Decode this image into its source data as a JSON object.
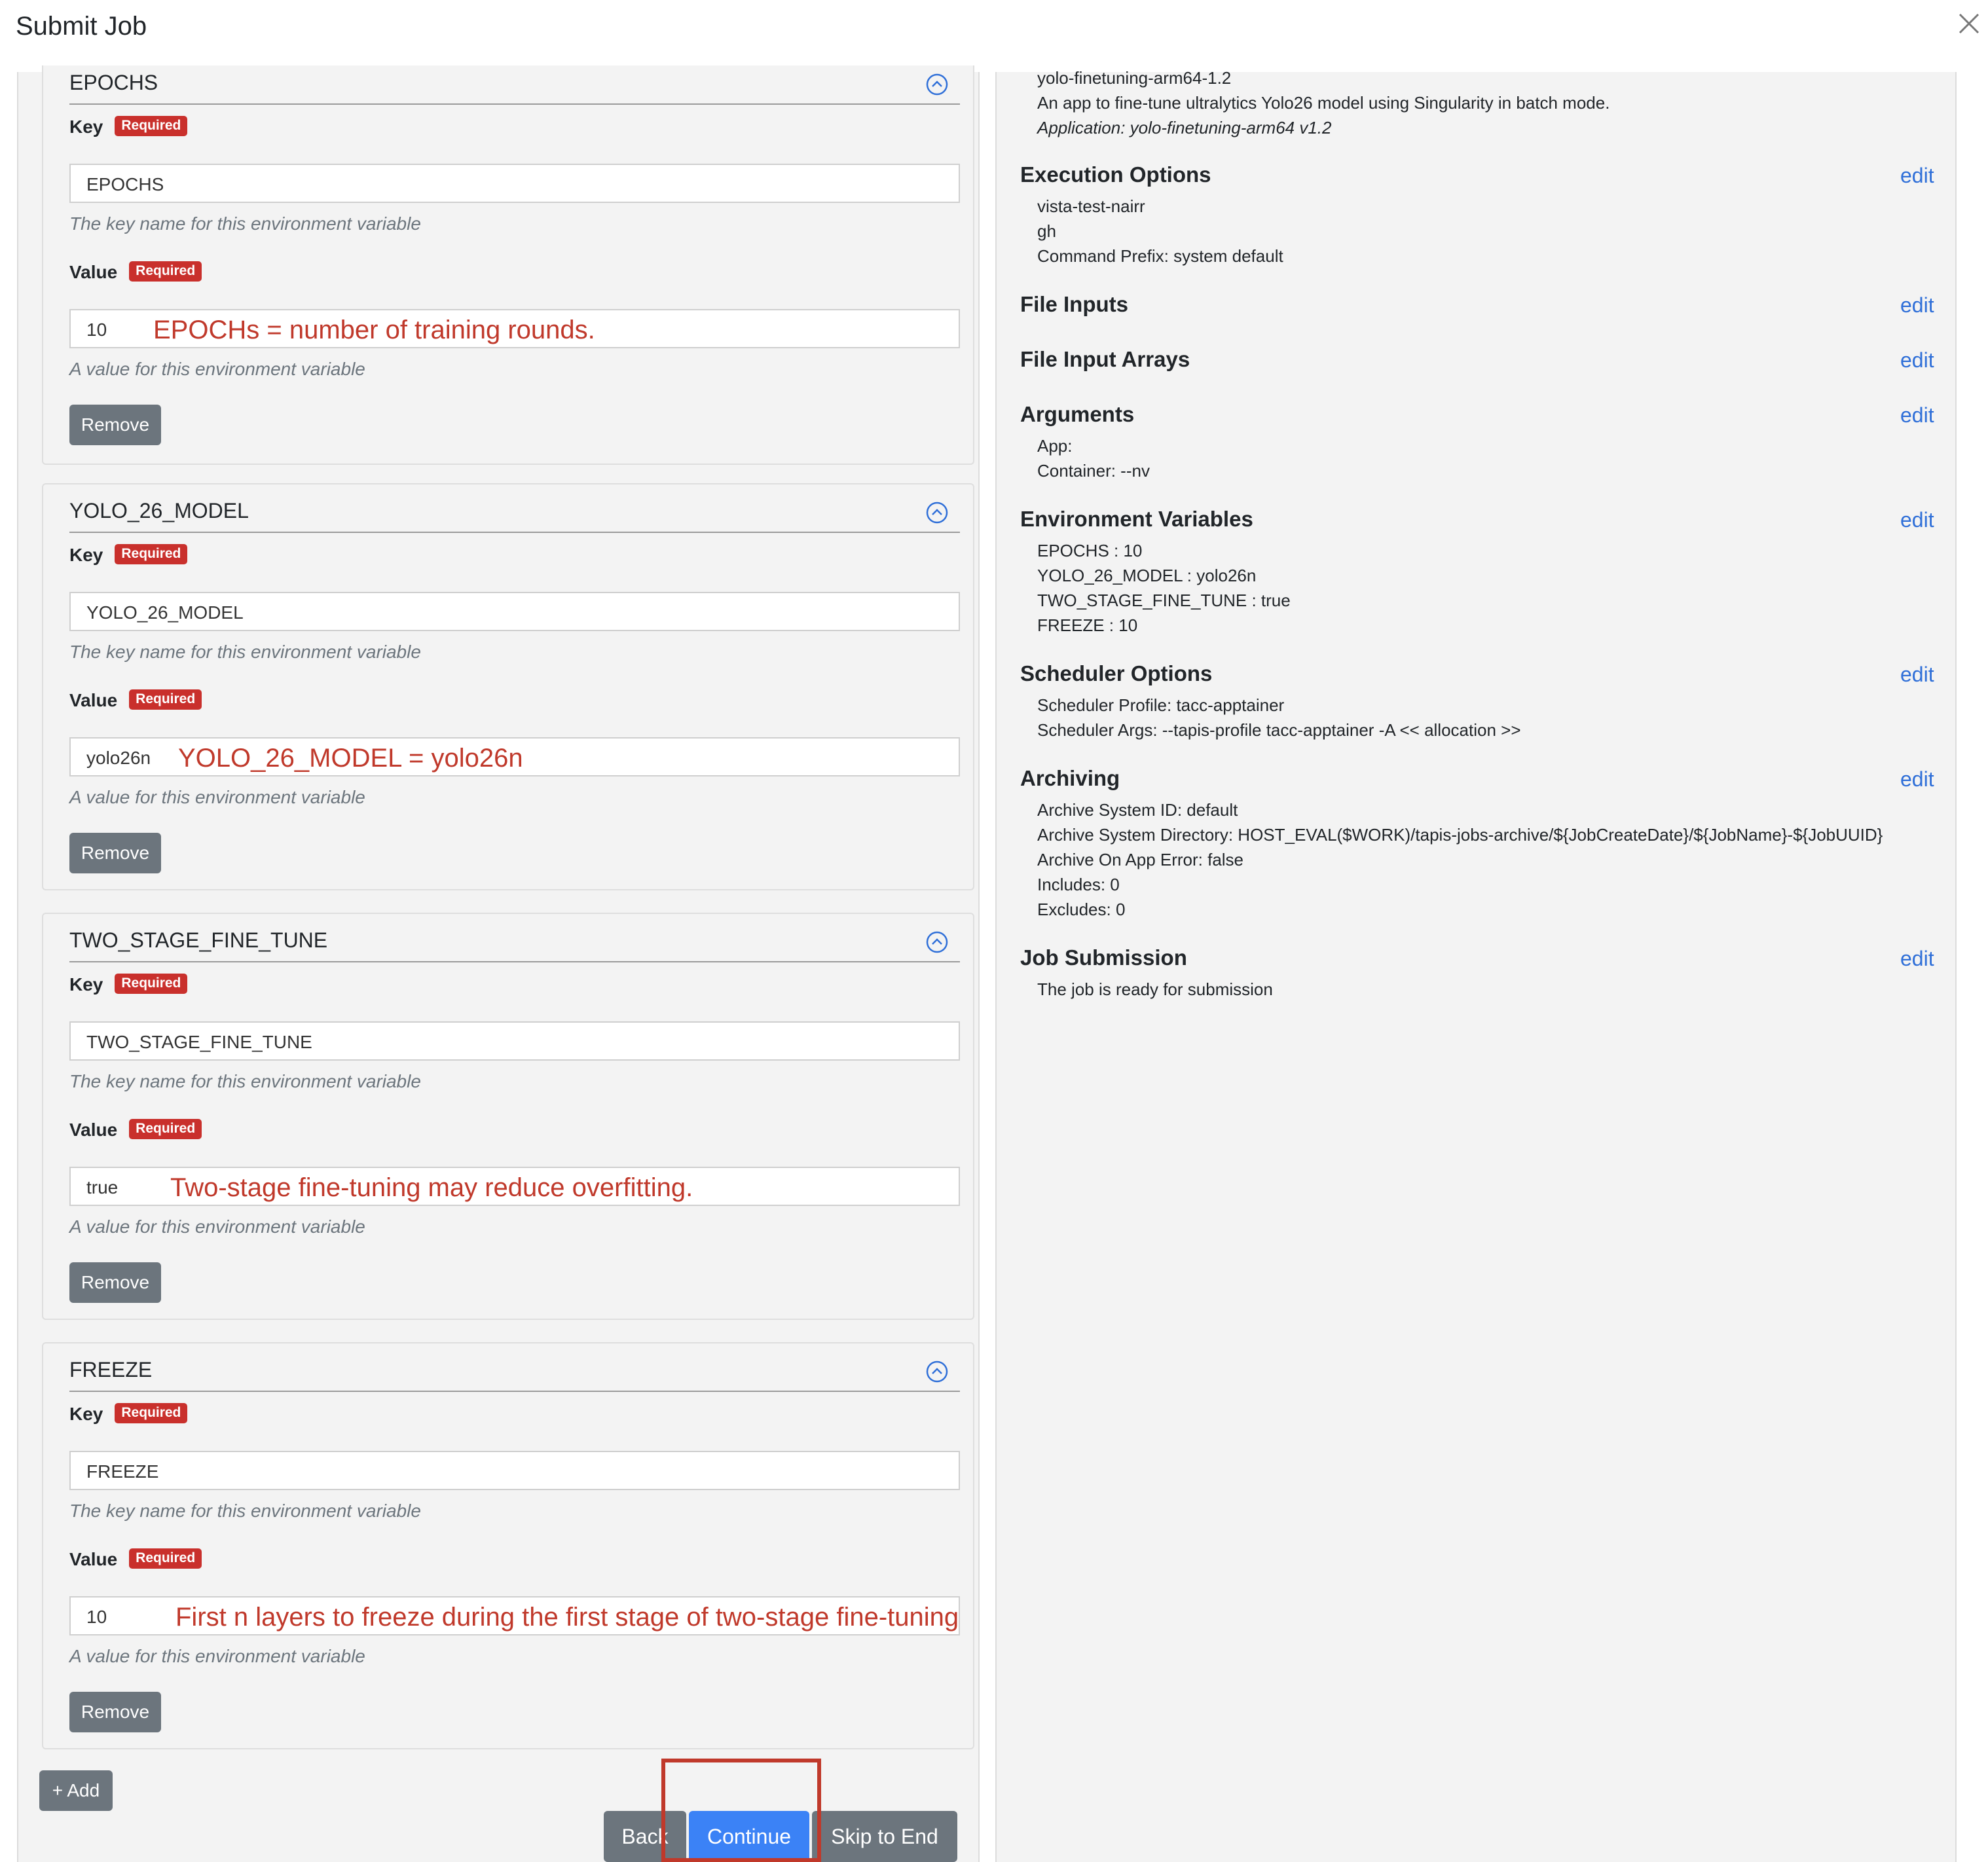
{
  "modal": {
    "title": "Submit Job"
  },
  "env_vars": [
    {
      "name": "EPOCHS",
      "key_label": "Key",
      "key_badge": "Required",
      "key_value": "EPOCHS",
      "key_help": "The key name for this environment variable",
      "value_label": "Value",
      "value_badge": "Required",
      "value": "10",
      "value_help": "A value for this environment variable",
      "annotation": "EPOCHs   = number of training rounds.",
      "remove_label": "Remove"
    },
    {
      "name": "YOLO_26_MODEL",
      "key_label": "Key",
      "key_badge": "Required",
      "key_value": "YOLO_26_MODEL",
      "key_help": "The key name for this environment variable",
      "value_label": "Value",
      "value_badge": "Required",
      "value": "yolo26n",
      "value_help": "A value for this environment variable",
      "annotation": "YOLO_26_MODEL = yolo26n",
      "remove_label": "Remove"
    },
    {
      "name": "TWO_STAGE_FINE_TUNE",
      "key_label": "Key",
      "key_badge": "Required",
      "key_value": "TWO_STAGE_FINE_TUNE",
      "key_help": "The key name for this environment variable",
      "value_label": "Value",
      "value_badge": "Required",
      "value": "true",
      "value_help": "A value for this environment variable",
      "annotation": "Two-stage fine-tuning may reduce overfitting.",
      "remove_label": "Remove"
    },
    {
      "name": "FREEZE",
      "key_label": "Key",
      "key_badge": "Required",
      "key_value": "FREEZE",
      "key_help": "The key name for this environment variable",
      "value_label": "Value",
      "value_badge": "Required",
      "value": "10",
      "value_help": "A value for this environment variable",
      "annotation": "First n layers to freeze during the first stage of two-stage fine-tuning",
      "remove_label": "Remove"
    }
  ],
  "actions": {
    "add_label": "+ Add",
    "back_label": "Back",
    "continue_label": "Continue",
    "skip_label": "Skip to End"
  },
  "summary": {
    "app": {
      "id": "yolo-finetuning-arm64-1.2",
      "description": "An app to fine-tune ultralytics Yolo26 model using Singularity in batch mode.",
      "application": "Application: yolo-finetuning-arm64 v1.2"
    },
    "edit_label": "edit",
    "execution_options": {
      "title": "Execution Options",
      "lines": [
        "vista-test-nairr",
        "gh",
        "Command Prefix: system default"
      ]
    },
    "file_inputs": {
      "title": "File Inputs"
    },
    "file_input_arrays": {
      "title": "File Input Arrays"
    },
    "arguments": {
      "title": "Arguments",
      "lines": [
        "App:",
        "Container: --nv"
      ]
    },
    "environment_variables": {
      "title": "Environment Variables",
      "lines": [
        "EPOCHS : 10",
        "YOLO_26_MODEL : yolo26n",
        "TWO_STAGE_FINE_TUNE : true",
        "FREEZE : 10"
      ]
    },
    "scheduler_options": {
      "title": "Scheduler Options",
      "lines": [
        "Scheduler Profile: tacc-apptainer",
        "Scheduler Args: --tapis-profile tacc-apptainer -A << allocation >>"
      ]
    },
    "archiving": {
      "title": "Archiving",
      "lines": [
        "Archive System ID: default",
        "Archive System Directory: HOST_EVAL($WORK)/tapis-jobs-archive/${JobCreateDate}/${JobName}-${JobUUID}",
        "Archive On App Error: false",
        "Includes: 0",
        "Excludes: 0"
      ]
    },
    "job_submission": {
      "title": "Job Submission",
      "lines": [
        "The job is ready for submission"
      ]
    }
  },
  "colors": {
    "primary": "#3b82f6",
    "secondary": "#6c757d",
    "required_badge": "#c9302c",
    "annotation": "#c0392b",
    "edit_link": "#2f6fd8"
  }
}
